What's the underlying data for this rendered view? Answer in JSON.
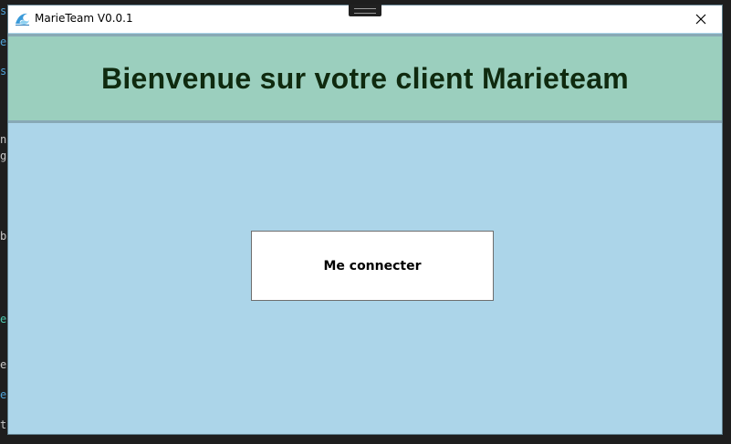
{
  "background_editor": {
    "chars": [
      {
        "text": "s",
        "color": "#4fa3d8"
      },
      {
        "text": "e",
        "color": "#4fa3d8"
      },
      {
        "text": "s",
        "color": "#4fa3d8"
      },
      {
        "text": "n",
        "color": "#c8c8c8"
      },
      {
        "text": "g",
        "color": "#c8c8c8"
      },
      {
        "text": "b",
        "color": "#c8c8c8"
      },
      {
        "text": "e",
        "color": "#4ec9b0"
      },
      {
        "text": "e",
        "color": "#c8c8c8"
      },
      {
        "text": "e",
        "color": "#4fa3d8"
      },
      {
        "text": "t",
        "color": "#c8c8c8"
      }
    ]
  },
  "window": {
    "title": "MarieTeam V0.0.1",
    "icon": "marieteam-wave-icon",
    "close_icon": "close-icon"
  },
  "header": {
    "title": "Bienvenue sur votre client Marieteam"
  },
  "main": {
    "connect_button_label": "Me connecter"
  },
  "colors": {
    "window_background": "#acd5e9",
    "header_background": "#9bcfbe",
    "title_text": "#0f2a0f",
    "button_background": "#ffffff"
  }
}
